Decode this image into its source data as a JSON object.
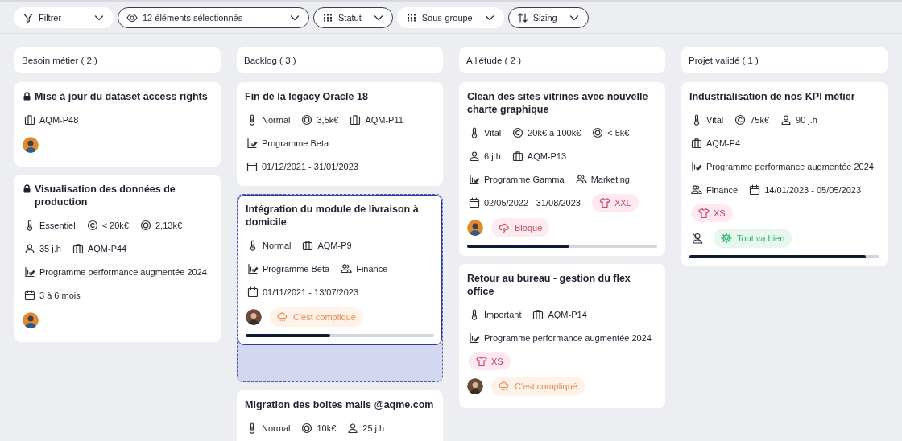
{
  "toolbar": [
    {
      "kind": "filter",
      "label": "Filtrer",
      "outlined": false
    },
    {
      "kind": "eye",
      "label": "12 éléments sélectionnés",
      "outlined": true
    },
    {
      "kind": "grid",
      "label": "Statut",
      "outlined": true
    },
    {
      "kind": "grid",
      "label": "Sous-groupe",
      "outlined": false
    },
    {
      "kind": "sort",
      "label": "Sizing",
      "outlined": true
    }
  ],
  "columns": [
    {
      "title": "Besoin métier ( 2 )",
      "cards": [
        {
          "title": "Mise à jour du dataset access rights",
          "locked": true,
          "dragging": false,
          "rows": [
            [
              {
                "kind": "project",
                "text": "AQM-P48"
              }
            ]
          ],
          "footer": {
            "avatar": {
              "kind": "person_a"
            }
          }
        },
        {
          "title": "Visualisation des données de production",
          "locked": true,
          "dragging": false,
          "rows": [
            [
              {
                "kind": "priority",
                "text": "Essentiel"
              },
              {
                "kind": "budget",
                "text": "< 20k€"
              },
              {
                "kind": "cost",
                "text": "2,13k€"
              }
            ],
            [
              {
                "kind": "effort",
                "text": "35 j.h"
              },
              {
                "kind": "project",
                "text": "AQM-P44"
              }
            ],
            [
              {
                "kind": "program",
                "text": "Programme performance augmentée 2024"
              }
            ],
            [
              {
                "kind": "date",
                "text": "3 à 6 mois"
              }
            ]
          ],
          "footer": {
            "avatar": {
              "kind": "person_a"
            }
          }
        }
      ]
    },
    {
      "title": "Backlog ( 3 )",
      "cards": [
        {
          "title": "Fin de la legacy Oracle 18",
          "locked": false,
          "dragging": false,
          "rows": [
            [
              {
                "kind": "priority",
                "text": "Normal"
              },
              {
                "kind": "cost",
                "text": "3,5k€"
              },
              {
                "kind": "project",
                "text": "AQM-P11"
              }
            ],
            [
              {
                "kind": "program",
                "text": "Programme Beta"
              }
            ],
            [
              {
                "kind": "date",
                "text": "01/12/2021 - 31/01/2023"
              }
            ]
          ]
        },
        {
          "title": "Intégration du module de livraison à domicile",
          "locked": false,
          "dragging": true,
          "rows": [
            [
              {
                "kind": "priority",
                "text": "Normal"
              },
              {
                "kind": "project",
                "text": "AQM-P9"
              }
            ],
            [
              {
                "kind": "program",
                "text": "Programme Beta"
              },
              {
                "kind": "team",
                "text": "Finance"
              }
            ],
            [
              {
                "kind": "date",
                "text": "01/11/2021 - 13/07/2023"
              }
            ]
          ],
          "footer": {
            "avatar": {
              "kind": "person_b"
            },
            "status": {
              "kind": "complicated",
              "text": "C'est compliqué"
            }
          },
          "level": 0.45
        },
        {
          "title": "Migration des boites mails @aqme.com",
          "locked": false,
          "dragging": false,
          "rows": [
            [
              {
                "kind": "priority",
                "text": "Normal"
              },
              {
                "kind": "cost",
                "text": "10k€"
              },
              {
                "kind": "effort",
                "text": "25 j.h"
              }
            ]
          ]
        }
      ]
    },
    {
      "title": "À l'étude ( 2 )",
      "cards": [
        {
          "title": "Clean des sites vitrines avec nouvelle charte graphique",
          "locked": false,
          "dragging": false,
          "rows": [
            [
              {
                "kind": "priority",
                "text": "Vital"
              },
              {
                "kind": "budget",
                "text": "20k€ à 100k€"
              },
              {
                "kind": "cost",
                "text": "< 5k€"
              }
            ],
            [
              {
                "kind": "effort",
                "text": "6 j.h"
              },
              {
                "kind": "project",
                "text": "AQM-P13"
              }
            ],
            [
              {
                "kind": "program",
                "text": "Programme Gamma"
              },
              {
                "kind": "team",
                "text": "Marketing"
              }
            ],
            [
              {
                "kind": "date",
                "text": "02/05/2022 - 31/08/2023"
              },
              {
                "kind": "size",
                "text": "XXL"
              }
            ]
          ],
          "footer": {
            "avatar": {
              "kind": "person_a"
            },
            "status": {
              "kind": "blocked",
              "text": "Bloqué"
            }
          },
          "level": 0.54
        },
        {
          "title": "Retour au bureau - gestion du flex office",
          "locked": false,
          "dragging": false,
          "rows": [
            [
              {
                "kind": "priority",
                "text": "Important"
              },
              {
                "kind": "project",
                "text": "AQM-P14"
              }
            ],
            [
              {
                "kind": "program",
                "text": "Programme performance augmentée 2024"
              }
            ],
            [
              {
                "kind": "size",
                "text": "XS"
              }
            ]
          ],
          "footer": {
            "avatar": {
              "kind": "person_b"
            },
            "status": {
              "kind": "complicated",
              "text": "C'est compliqué"
            }
          }
        }
      ]
    },
    {
      "title": "Projet validé ( 1 )",
      "cards": [
        {
          "title": "Industrialisation de nos KPI métier",
          "locked": false,
          "dragging": false,
          "rows": [
            [
              {
                "kind": "priority",
                "text": "Vital"
              },
              {
                "kind": "budget",
                "text": "75k€"
              },
              {
                "kind": "effort",
                "text": "90 j.h"
              }
            ],
            [
              {
                "kind": "project",
                "text": "AQM-P4"
              }
            ],
            [
              {
                "kind": "program",
                "text": "Programme performance augmentée 2024"
              }
            ],
            [
              {
                "kind": "team",
                "text": "Finance"
              },
              {
                "kind": "date",
                "text": "14/01/2023 - 05/05/2023"
              }
            ],
            [
              {
                "kind": "size",
                "text": "XS"
              }
            ]
          ],
          "footer": {
            "avatar": {
              "kind": "unassigned"
            },
            "status": {
              "kind": "fine",
              "text": "Tout va bien"
            }
          },
          "level": 0.93
        }
      ]
    }
  ]
}
